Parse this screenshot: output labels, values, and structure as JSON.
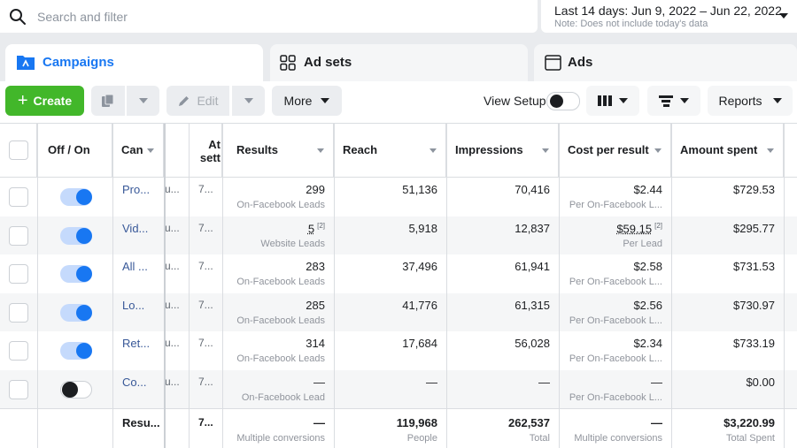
{
  "search": {
    "placeholder": "Search and filter"
  },
  "date_range": {
    "label": "Last 14 days: Jun 9, 2022 – Jun 22, 2022",
    "note": "Note: Does not include today's data"
  },
  "tabs": [
    {
      "label": "Campaigns",
      "active": true
    },
    {
      "label": "Ad sets",
      "active": false
    },
    {
      "label": "Ads",
      "active": false
    }
  ],
  "toolbar": {
    "create_label": "Create",
    "edit_label": "Edit",
    "more_label": "More",
    "view_setup_label": "View Setup",
    "reports_label": "Reports"
  },
  "columns": {
    "off_on": "Off / On",
    "campaign": "Can",
    "attribution": "At sett",
    "results": "Results",
    "reach": "Reach",
    "impressions": "Impressions",
    "cost_per_result": "Cost per result",
    "amount_spent": "Amount spent"
  },
  "rows": [
    {
      "on": true,
      "name": "Pro...",
      "bid": "u...",
      "attr": "7...",
      "results": "299",
      "results_sub": "On-Facebook Leads",
      "reach": "51,136",
      "impressions": "70,416",
      "cost": "$2.44",
      "cost_sub": "Per On-Facebook L...",
      "spent": "$729.53"
    },
    {
      "on": true,
      "name": "Vid...",
      "bid": "u...",
      "attr": "7...",
      "results": "5",
      "results_sup": "[2]",
      "results_sub": "Website Leads",
      "reach": "5,918",
      "impressions": "12,837",
      "cost": "$59.15",
      "cost_sup": "[2]",
      "cost_sub": "Per Lead",
      "spent": "$295.77"
    },
    {
      "on": true,
      "name": "All ...",
      "bid": "u...",
      "attr": "7...",
      "results": "283",
      "results_sub": "On-Facebook Leads",
      "reach": "37,496",
      "impressions": "61,941",
      "cost": "$2.58",
      "cost_sub": "Per On-Facebook L...",
      "spent": "$731.53"
    },
    {
      "on": true,
      "name": "Lo...",
      "bid": "u...",
      "attr": "7...",
      "results": "285",
      "results_sub": "On-Facebook Leads",
      "reach": "41,776",
      "impressions": "61,315",
      "cost": "$2.56",
      "cost_sub": "Per On-Facebook L...",
      "spent": "$730.97"
    },
    {
      "on": true,
      "name": "Ret...",
      "bid": "u...",
      "attr": "7...",
      "results": "314",
      "results_sub": "On-Facebook Leads",
      "reach": "17,684",
      "impressions": "56,028",
      "cost": "$2.34",
      "cost_sub": "Per On-Facebook L...",
      "spent": "$733.19"
    },
    {
      "on": false,
      "name": "Co...",
      "bid": "u...",
      "attr": "7...",
      "results": "—",
      "results_sub": "On-Facebook Lead",
      "reach": "—",
      "impressions": "—",
      "cost": "—",
      "cost_sub": "Per On-Facebook L...",
      "spent": "$0.00"
    }
  ],
  "totals": {
    "name": "Resu...",
    "attr": "7...",
    "results": "—",
    "results_sub": "Multiple conversions",
    "reach": "119,968",
    "reach_sub": "People",
    "impressions": "262,537",
    "impressions_sub": "Total",
    "cost": "—",
    "cost_sub": "Multiple conversions",
    "spent": "$3,220.99",
    "spent_sub": "Total Spent"
  },
  "colors": {
    "accent": "#1877f2",
    "create": "#42b72a",
    "link": "#385898"
  }
}
